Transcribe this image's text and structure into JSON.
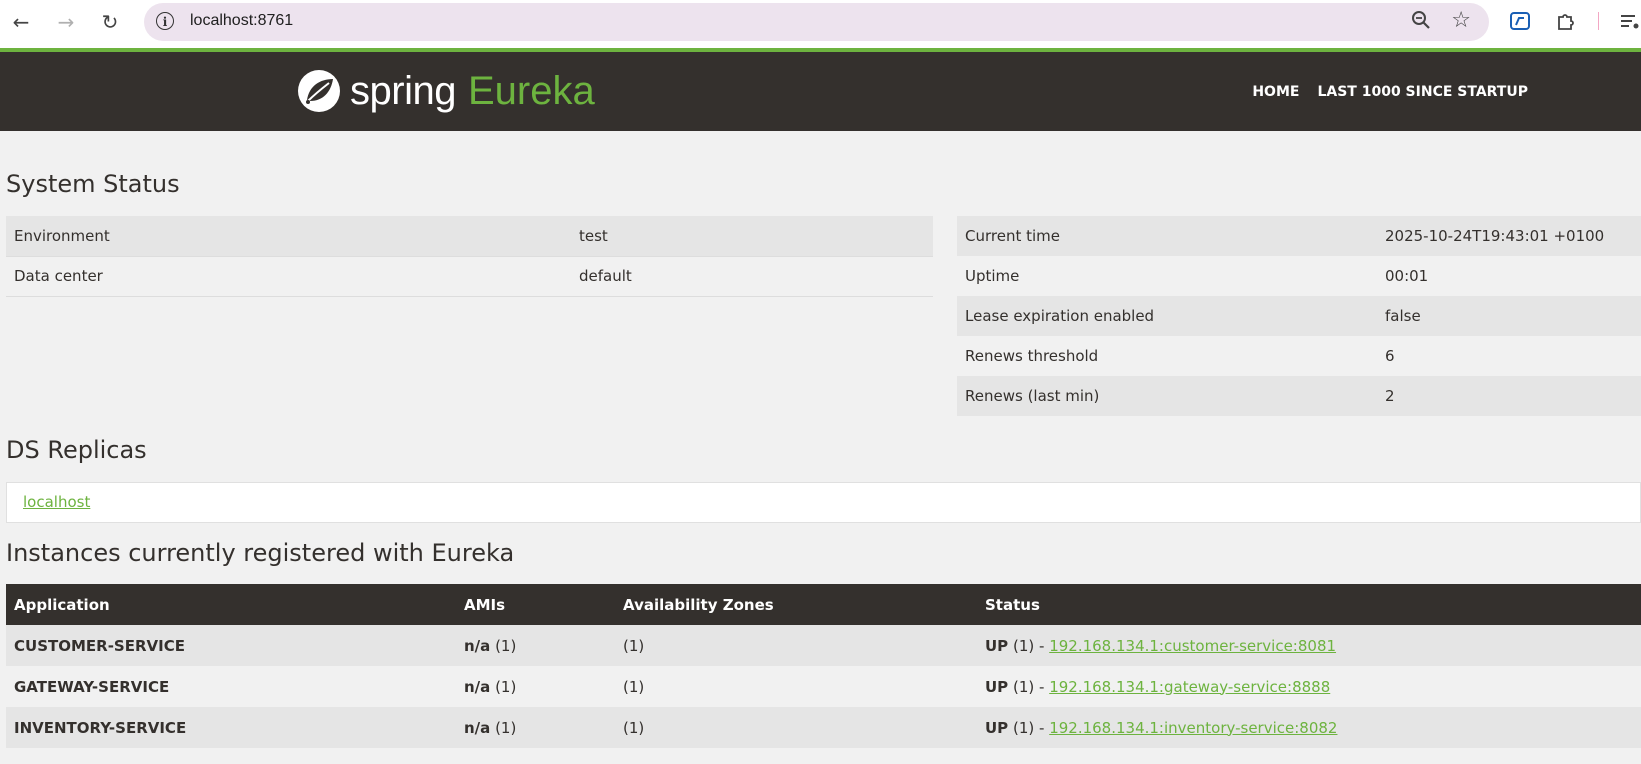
{
  "browser": {
    "url": "localhost:8761",
    "icons": [
      "back-arrow-icon",
      "forward-arrow-icon",
      "reload-icon",
      "site-info-icon",
      "zoom-icon",
      "star-icon",
      "extension-icon",
      "puzzle-icon",
      "reading-list-icon"
    ]
  },
  "header": {
    "brand_spring": "spring",
    "brand_eureka": "Eureka",
    "nav": [
      "HOME",
      "LAST 1000 SINCE STARTUP"
    ],
    "colors": {
      "bar": "#34302d",
      "accent": "#6db33f"
    }
  },
  "system_status": {
    "title": "System Status",
    "left": [
      {
        "key": "Environment",
        "value": "test"
      },
      {
        "key": "Data center",
        "value": "default"
      }
    ],
    "right": [
      {
        "key": "Current time",
        "value": "2025-10-24T19:43:01 +0100"
      },
      {
        "key": "Uptime",
        "value": "00:01"
      },
      {
        "key": "Lease expiration enabled",
        "value": "false"
      },
      {
        "key": "Renews threshold",
        "value": "6"
      },
      {
        "key": "Renews (last min)",
        "value": "2"
      }
    ]
  },
  "replicas": {
    "title": "DS Replicas",
    "items": [
      "localhost"
    ]
  },
  "instances": {
    "title": "Instances currently registered with Eureka",
    "columns": [
      "Application",
      "AMIs",
      "Availability Zones",
      "Status"
    ],
    "rows": [
      {
        "app": "CUSTOMER-SERVICE",
        "ami": "n/a",
        "ami_count": "(1)",
        "zones": "(1)",
        "status": "UP",
        "status_count": "(1) -",
        "link": "192.168.134.1:customer-service:8081"
      },
      {
        "app": "GATEWAY-SERVICE",
        "ami": "n/a",
        "ami_count": "(1)",
        "zones": "(1)",
        "status": "UP",
        "status_count": "(1) -",
        "link": "192.168.134.1:gateway-service:8888"
      },
      {
        "app": "INVENTORY-SERVICE",
        "ami": "n/a",
        "ami_count": "(1)",
        "zones": "(1)",
        "status": "UP",
        "status_count": "(1) -",
        "link": "192.168.134.1:inventory-service:8082"
      }
    ]
  }
}
